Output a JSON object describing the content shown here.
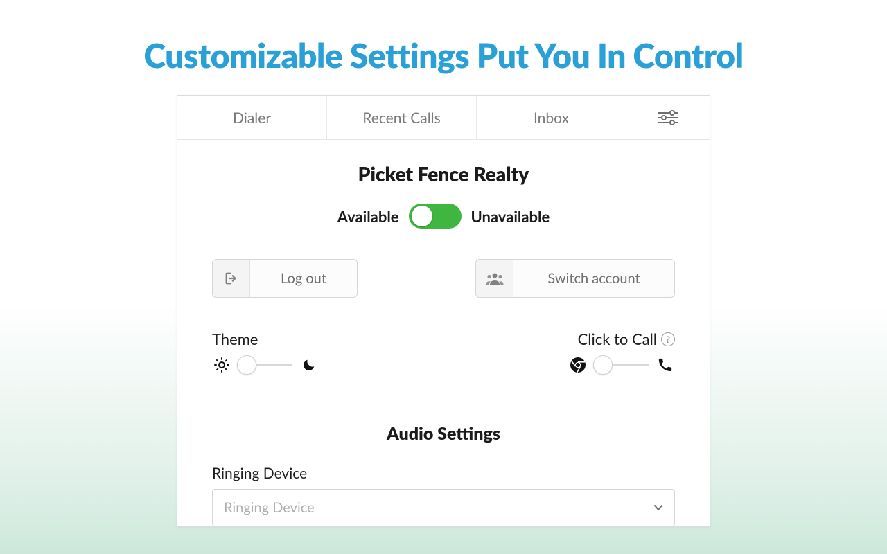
{
  "headline": "Customizable Settings Put You In Control",
  "tabs": {
    "dialer": "Dialer",
    "recent": "Recent Calls",
    "inbox": "Inbox"
  },
  "org": {
    "name": "Picket Fence Realty"
  },
  "availability": {
    "available_label": "Available",
    "unavailable_label": "Unavailable",
    "state": "available"
  },
  "buttons": {
    "logout": "Log out",
    "switch_account": "Switch account"
  },
  "sliders": {
    "theme": {
      "label": "Theme"
    },
    "click_to_call": {
      "label": "Click to Call"
    }
  },
  "audio": {
    "title": "Audio Settings",
    "ringing_device_label": "Ringing Device",
    "ringing_device_placeholder": "Ringing Device"
  }
}
